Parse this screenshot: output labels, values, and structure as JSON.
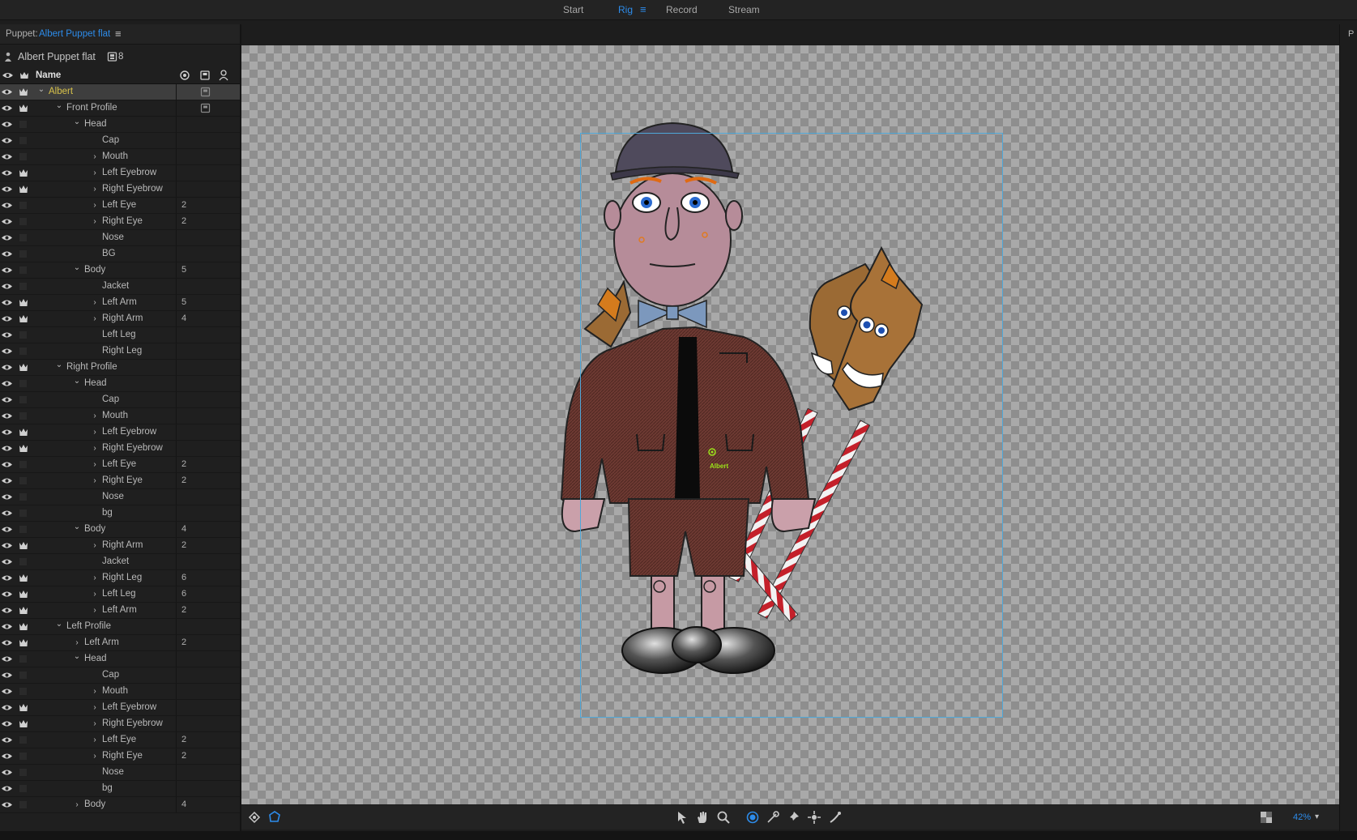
{
  "top_tabs": [
    {
      "label": "Start",
      "active": false
    },
    {
      "label": "Rig",
      "active": true
    },
    {
      "label": "Record",
      "active": false
    },
    {
      "label": "Stream",
      "active": false
    }
  ],
  "puppet_panel": {
    "label": "Puppet:",
    "puppet_name": "Albert Puppet flat",
    "title": "Albert Puppet flat",
    "count": "8",
    "column_name": "Name"
  },
  "rows": [
    {
      "label": "Albert",
      "depth": 0,
      "twisty": "open",
      "crown": true,
      "num": "",
      "selected": true,
      "lock": true
    },
    {
      "label": "Front Profile",
      "depth": 1,
      "twisty": "open",
      "crown": true,
      "num": "",
      "lock": true
    },
    {
      "label": "Head",
      "depth": 2,
      "twisty": "open",
      "crown": false,
      "num": ""
    },
    {
      "label": "Cap",
      "depth": 3,
      "twisty": "none",
      "crown": false,
      "num": ""
    },
    {
      "label": "Mouth",
      "depth": 3,
      "twisty": "closed",
      "crown": false,
      "num": ""
    },
    {
      "label": "Left Eyebrow",
      "depth": 3,
      "twisty": "closed",
      "crown": true,
      "num": ""
    },
    {
      "label": "Right Eyebrow",
      "depth": 3,
      "twisty": "closed",
      "crown": true,
      "num": ""
    },
    {
      "label": "Left Eye",
      "depth": 3,
      "twisty": "closed",
      "crown": false,
      "num": "2"
    },
    {
      "label": "Right Eye",
      "depth": 3,
      "twisty": "closed",
      "crown": false,
      "num": "2"
    },
    {
      "label": "Nose",
      "depth": 3,
      "twisty": "none",
      "crown": false,
      "num": ""
    },
    {
      "label": "BG",
      "depth": 3,
      "twisty": "none",
      "crown": false,
      "num": ""
    },
    {
      "label": "Body",
      "depth": 2,
      "twisty": "open",
      "crown": false,
      "num": "5"
    },
    {
      "label": "Jacket",
      "depth": 3,
      "twisty": "none",
      "crown": false,
      "num": ""
    },
    {
      "label": "Left Arm",
      "depth": 3,
      "twisty": "closed",
      "crown": true,
      "num": "5"
    },
    {
      "label": "Right Arm",
      "depth": 3,
      "twisty": "closed",
      "crown": true,
      "num": "4"
    },
    {
      "label": "Left Leg",
      "depth": 3,
      "twisty": "none",
      "crown": false,
      "num": ""
    },
    {
      "label": "Right Leg",
      "depth": 3,
      "twisty": "none",
      "crown": false,
      "num": ""
    },
    {
      "label": "Right Profile",
      "depth": 1,
      "twisty": "open",
      "crown": true,
      "num": ""
    },
    {
      "label": "Head",
      "depth": 2,
      "twisty": "open",
      "crown": false,
      "num": ""
    },
    {
      "label": "Cap",
      "depth": 3,
      "twisty": "none",
      "crown": false,
      "num": ""
    },
    {
      "label": "Mouth",
      "depth": 3,
      "twisty": "closed",
      "crown": false,
      "num": ""
    },
    {
      "label": "Left Eyebrow",
      "depth": 3,
      "twisty": "closed",
      "crown": true,
      "num": ""
    },
    {
      "label": "Right Eyebrow",
      "depth": 3,
      "twisty": "closed",
      "crown": true,
      "num": ""
    },
    {
      "label": "Left Eye",
      "depth": 3,
      "twisty": "closed",
      "crown": false,
      "num": "2"
    },
    {
      "label": "Right Eye",
      "depth": 3,
      "twisty": "closed",
      "crown": false,
      "num": "2"
    },
    {
      "label": "Nose",
      "depth": 3,
      "twisty": "none",
      "crown": false,
      "num": ""
    },
    {
      "label": "bg",
      "depth": 3,
      "twisty": "none",
      "crown": false,
      "num": ""
    },
    {
      "label": "Body",
      "depth": 2,
      "twisty": "open",
      "crown": false,
      "num": "4"
    },
    {
      "label": "Right Arm",
      "depth": 3,
      "twisty": "closed",
      "crown": true,
      "num": "2"
    },
    {
      "label": "Jacket",
      "depth": 3,
      "twisty": "none",
      "crown": false,
      "num": ""
    },
    {
      "label": "Right Leg",
      "depth": 3,
      "twisty": "closed",
      "crown": true,
      "num": "6"
    },
    {
      "label": "Left Leg",
      "depth": 3,
      "twisty": "closed",
      "crown": true,
      "num": "6"
    },
    {
      "label": "Left Arm",
      "depth": 3,
      "twisty": "closed",
      "crown": true,
      "num": "2"
    },
    {
      "label": "Left Profile",
      "depth": 1,
      "twisty": "open",
      "crown": true,
      "num": ""
    },
    {
      "label": "Left Arm",
      "depth": 2,
      "twisty": "closed",
      "crown": true,
      "num": "2"
    },
    {
      "label": "Head",
      "depth": 2,
      "twisty": "open",
      "crown": false,
      "num": ""
    },
    {
      "label": "Cap",
      "depth": 3,
      "twisty": "none",
      "crown": false,
      "num": ""
    },
    {
      "label": "Mouth",
      "depth": 3,
      "twisty": "closed",
      "crown": false,
      "num": ""
    },
    {
      "label": "Left Eyebrow",
      "depth": 3,
      "twisty": "closed",
      "crown": true,
      "num": ""
    },
    {
      "label": "Right Eyebrow",
      "depth": 3,
      "twisty": "closed",
      "crown": true,
      "num": ""
    },
    {
      "label": "Left Eye",
      "depth": 3,
      "twisty": "closed",
      "crown": false,
      "num": "2"
    },
    {
      "label": "Right Eye",
      "depth": 3,
      "twisty": "closed",
      "crown": false,
      "num": "2"
    },
    {
      "label": "Nose",
      "depth": 3,
      "twisty": "none",
      "crown": false,
      "num": ""
    },
    {
      "label": "bg",
      "depth": 3,
      "twisty": "none",
      "crown": false,
      "num": ""
    },
    {
      "label": "Body",
      "depth": 2,
      "twisty": "closed",
      "crown": false,
      "num": "4"
    }
  ],
  "canvas": {
    "origin_label": "Albert"
  },
  "toolbar": {
    "zoom": "42%",
    "icons": [
      "selection-icon",
      "hand-icon",
      "zoom-icon",
      "origin-icon",
      "dragger-icon",
      "pin-icon",
      "fixed-handle-icon",
      "stick-icon"
    ]
  },
  "right_strip": {
    "letter": "P"
  },
  "colors": {
    "accent": "#2d8ceb",
    "selected_label": "#d8c24a",
    "origin": "#9be31a",
    "bounds": "#4fa7d8"
  }
}
